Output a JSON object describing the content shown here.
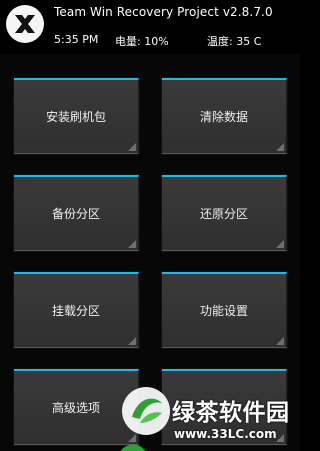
{
  "header": {
    "title": "Team Win Recovery Project  v2.8.7.0",
    "time": "5:35 PM",
    "battery": "电量: 10%",
    "temperature": "温度: 35 C"
  },
  "menu": {
    "install": "安装刷机包",
    "wipe": "清除数据",
    "backup": "备份分区",
    "restore": "还原分区",
    "mount": "挂载分区",
    "settings": "功能设置",
    "advanced": "高级选项",
    "reboot": ""
  },
  "watermark": {
    "text": "绿茶软件园",
    "url": "www.33LC.com"
  },
  "colors": {
    "background": "#000000",
    "tile": "#353535",
    "accent": "#27b7e6"
  }
}
